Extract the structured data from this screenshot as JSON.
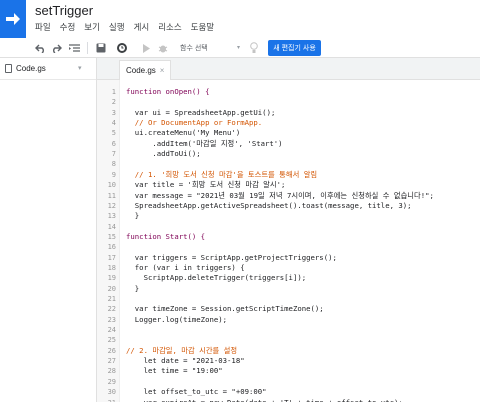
{
  "app": {
    "title": "setTrigger",
    "menu": [
      "파일",
      "수정",
      "보기",
      "실행",
      "게시",
      "리소스",
      "도움말"
    ]
  },
  "toolbar": {
    "function_select": "함수 선택",
    "new_editor": "새 편집기 사용"
  },
  "files": {
    "current": "Code.gs"
  },
  "editor": {
    "tab": "Code.gs",
    "lines": [
      {
        "n": "1",
        "t": "function onOpen() {",
        "c": "kw"
      },
      {
        "n": "2",
        "t": "",
        "c": "pl"
      },
      {
        "n": "3",
        "t": "  var ui = SpreadsheetApp.getUi();",
        "c": "pl"
      },
      {
        "n": "4",
        "t": "  // Or DocumentApp or FormApp.",
        "c": "cm"
      },
      {
        "n": "5",
        "t": "  ui.createMenu('My Menu')",
        "c": "pl"
      },
      {
        "n": "6",
        "t": "      .addItem('마감일 지정', 'Start')",
        "c": "pl"
      },
      {
        "n": "7",
        "t": "      .addToUi();",
        "c": "pl"
      },
      {
        "n": "8",
        "t": "",
        "c": "pl"
      },
      {
        "n": "9",
        "t": "  // 1. '희망 도서 신청 마감'을 토스트를 통해서 알림",
        "c": "cm"
      },
      {
        "n": "10",
        "t": "  var title = '희망 도서 신청 마감 알시';",
        "c": "pl"
      },
      {
        "n": "11",
        "t": "  var message = \"2021년 03월 19일 저녁 7시이며, 이후에는 신청하실 수 없습니다!\";",
        "c": "pl"
      },
      {
        "n": "12",
        "t": "  SpreadsheetApp.getActiveSpreadsheet().toast(message, title, 3);",
        "c": "pl"
      },
      {
        "n": "13",
        "t": "  }",
        "c": "pl"
      },
      {
        "n": "14",
        "t": "",
        "c": "pl"
      },
      {
        "n": "15",
        "t": "function Start() {",
        "c": "kw"
      },
      {
        "n": "16",
        "t": "",
        "c": "pl"
      },
      {
        "n": "17",
        "t": "  var triggers = ScriptApp.getProjectTriggers();",
        "c": "pl"
      },
      {
        "n": "18",
        "t": "  for (var i in triggers) {",
        "c": "pl"
      },
      {
        "n": "19",
        "t": "    ScriptApp.deleteTrigger(triggers[i]);",
        "c": "pl"
      },
      {
        "n": "20",
        "t": "  }",
        "c": "pl"
      },
      {
        "n": "21",
        "t": "",
        "c": "pl"
      },
      {
        "n": "22",
        "t": "  var timeZone = Session.getScriptTimeZone();",
        "c": "pl"
      },
      {
        "n": "23",
        "t": "  Logger.log(timeZone);",
        "c": "pl"
      },
      {
        "n": "24",
        "t": "",
        "c": "pl"
      },
      {
        "n": "25",
        "t": "",
        "c": "pl"
      },
      {
        "n": "26",
        "t": "// 2. 마감일, 마감 시간를 설정",
        "c": "cm"
      },
      {
        "n": "27",
        "t": "    let date = \"2021-03-18\"",
        "c": "pl"
      },
      {
        "n": "28",
        "t": "    let time = \"19:00\"",
        "c": "pl"
      },
      {
        "n": "29",
        "t": "",
        "c": "pl"
      },
      {
        "n": "30",
        "t": "    let offset_to_utc = \"+09:00\"",
        "c": "pl"
      },
      {
        "n": "31",
        "t": "    var expireAt = new Date(date + 'T' + time + offset_to_utc);",
        "c": "pl"
      },
      {
        "n": "32",
        "t": "",
        "c": "pl"
      }
    ]
  },
  "colors": {
    "accent": "#1a73e8",
    "keyword": "#7f0055",
    "string": "#a31515",
    "comment": "#d35400"
  }
}
